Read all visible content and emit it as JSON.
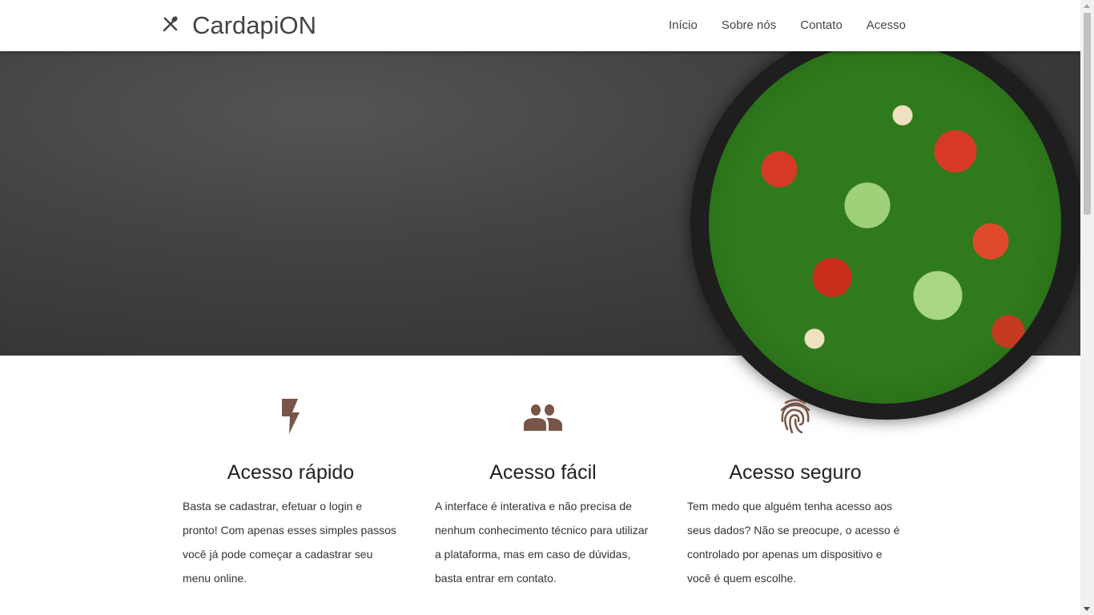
{
  "header": {
    "brand": "CardapiON",
    "nav": [
      "Início",
      "Sobre nós",
      "Contato",
      "Acesso"
    ]
  },
  "hero": {
    "image": "salad-bowl"
  },
  "features": [
    {
      "icon": "lightning-icon",
      "title": "Acesso rápido",
      "text": "Basta se cadastrar, efetuar o login e pronto! Com apenas esses simples passos você já pode começar a cadastrar seu menu online."
    },
    {
      "icon": "people-icon",
      "title": "Acesso fácil",
      "text": "A interface é interativa e não precisa de nenhum conhecimento técnico para utilizar a plataforma, mas em caso de dúvidas, basta entrar em contato."
    },
    {
      "icon": "fingerprint-icon",
      "title": "Acesso seguro",
      "text": "Tem medo que alguém tenha acesso aos seus dados? Não se preocupe, o acesso é controlado por apenas um dispositivo e você é quem escolhe."
    }
  ],
  "colors": {
    "accent": "#795548"
  }
}
